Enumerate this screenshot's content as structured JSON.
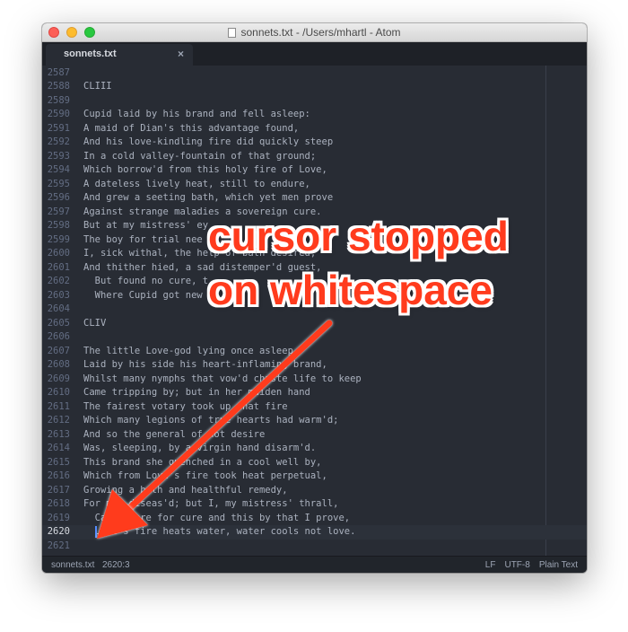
{
  "window": {
    "title": "sonnets.txt - /Users/mhartl - Atom"
  },
  "tabs": [
    {
      "label": "sonnets.txt",
      "close": "×"
    }
  ],
  "lines": [
    {
      "n": "2587",
      "t": ""
    },
    {
      "n": "2588",
      "t": "CLIII"
    },
    {
      "n": "2589",
      "t": ""
    },
    {
      "n": "2590",
      "t": "Cupid laid by his brand and fell asleep:"
    },
    {
      "n": "2591",
      "t": "A maid of Dian's this advantage found,"
    },
    {
      "n": "2592",
      "t": "And his love-kindling fire did quickly steep"
    },
    {
      "n": "2593",
      "t": "In a cold valley-fountain of that ground;"
    },
    {
      "n": "2594",
      "t": "Which borrow'd from this holy fire of Love,"
    },
    {
      "n": "2595",
      "t": "A dateless lively heat, still to endure,"
    },
    {
      "n": "2596",
      "t": "And grew a seeting bath, which yet men prove"
    },
    {
      "n": "2597",
      "t": "Against strange maladies a sovereign cure."
    },
    {
      "n": "2598",
      "t": "But at my mistress' ey"
    },
    {
      "n": "2599",
      "t": "The boy for trial nee"
    },
    {
      "n": "2600",
      "t": "I, sick withal, the help of bath desired,"
    },
    {
      "n": "2601",
      "t": "And thither hied, a sad distemper'd guest,"
    },
    {
      "n": "2602",
      "t": "  But found no cure, t"
    },
    {
      "n": "2603",
      "t": "  Where Cupid got new"
    },
    {
      "n": "2604",
      "t": ""
    },
    {
      "n": "2605",
      "t": "CLIV"
    },
    {
      "n": "2606",
      "t": ""
    },
    {
      "n": "2607",
      "t": "The little Love-god lying once asleep,"
    },
    {
      "n": "2608",
      "t": "Laid by his side his heart-inflaming brand,"
    },
    {
      "n": "2609",
      "t": "Whilst many nymphs that vow'd chaste life to keep"
    },
    {
      "n": "2610",
      "t": "Came tripping by; but in her maiden hand"
    },
    {
      "n": "2611",
      "t": "The fairest votary took up that fire"
    },
    {
      "n": "2612",
      "t": "Which many legions of true hearts had warm'd;"
    },
    {
      "n": "2613",
      "t": "And so the general of hot desire"
    },
    {
      "n": "2614",
      "t": "Was, sleeping, by a virgin hand disarm'd."
    },
    {
      "n": "2615",
      "t": "This brand she quenched in a cool well by,"
    },
    {
      "n": "2616",
      "t": "Which from Love's fire took heat perpetual,"
    },
    {
      "n": "2617",
      "t": "Growing a bath and healthful remedy,"
    },
    {
      "n": "2618",
      "t": "For men diseas'd; but I, my mistress' thrall,"
    },
    {
      "n": "2619",
      "t": "  Came there for cure and this by that I prove,"
    },
    {
      "n": "2620",
      "t": "  Love's fire heats water, water cools not love."
    },
    {
      "n": "2621",
      "t": ""
    }
  ],
  "status": {
    "file": "sonnets.txt",
    "cursor": "2620:3",
    "line_ending": "LF",
    "encoding": "UTF-8",
    "grammar": "Plain Text"
  },
  "annotation": {
    "line1": "cursor stopped",
    "line2": "on whitespace",
    "color": "#ff3b1d"
  }
}
